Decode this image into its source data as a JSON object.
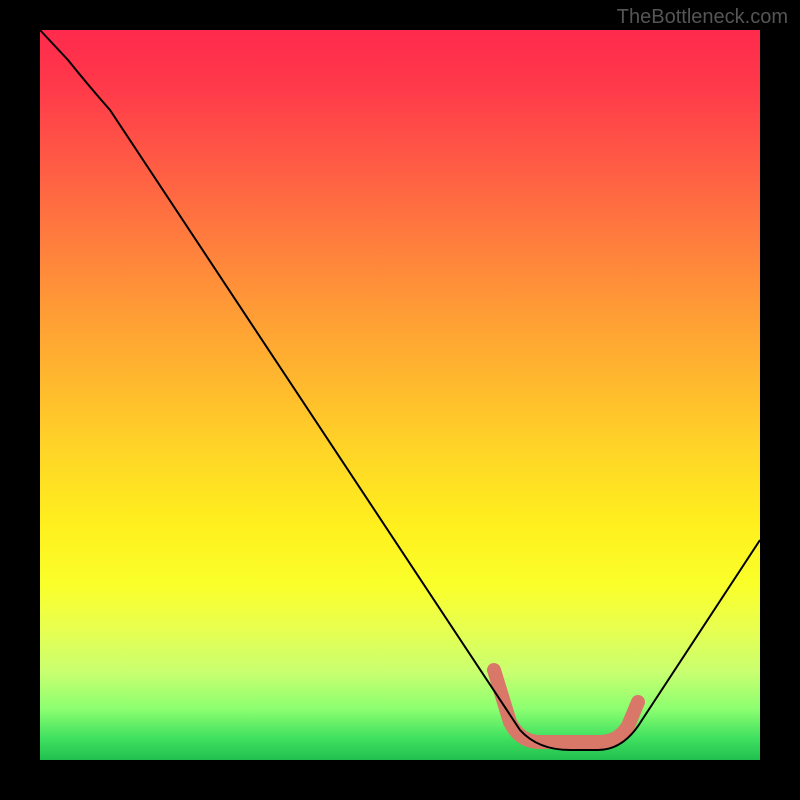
{
  "attribution": "TheBottleneck.com",
  "chart_data": {
    "type": "line",
    "title": "",
    "xlabel": "",
    "ylabel": "",
    "xlim": [
      0,
      100
    ],
    "ylim": [
      0,
      100
    ],
    "grid": false,
    "legend": false,
    "series": [
      {
        "name": "main-curve",
        "x": [
          0,
          5,
          10,
          20,
          30,
          40,
          50,
          58,
          64,
          70,
          76,
          80,
          85,
          92,
          100
        ],
        "y": [
          100,
          95,
          91,
          78,
          65,
          52,
          38,
          25,
          12,
          3,
          2,
          2,
          4,
          12,
          28
        ]
      }
    ],
    "highlight_segment": {
      "name": "flat-bottom",
      "x_range": [
        64,
        82
      ],
      "y_approx": 2
    },
    "color_gradient": {
      "direction": "vertical",
      "stops": [
        "#ff2a4d",
        "#ffb82e",
        "#fff01e",
        "#20c050"
      ],
      "meaning": "background heatmap red-to-green top-to-bottom"
    }
  }
}
